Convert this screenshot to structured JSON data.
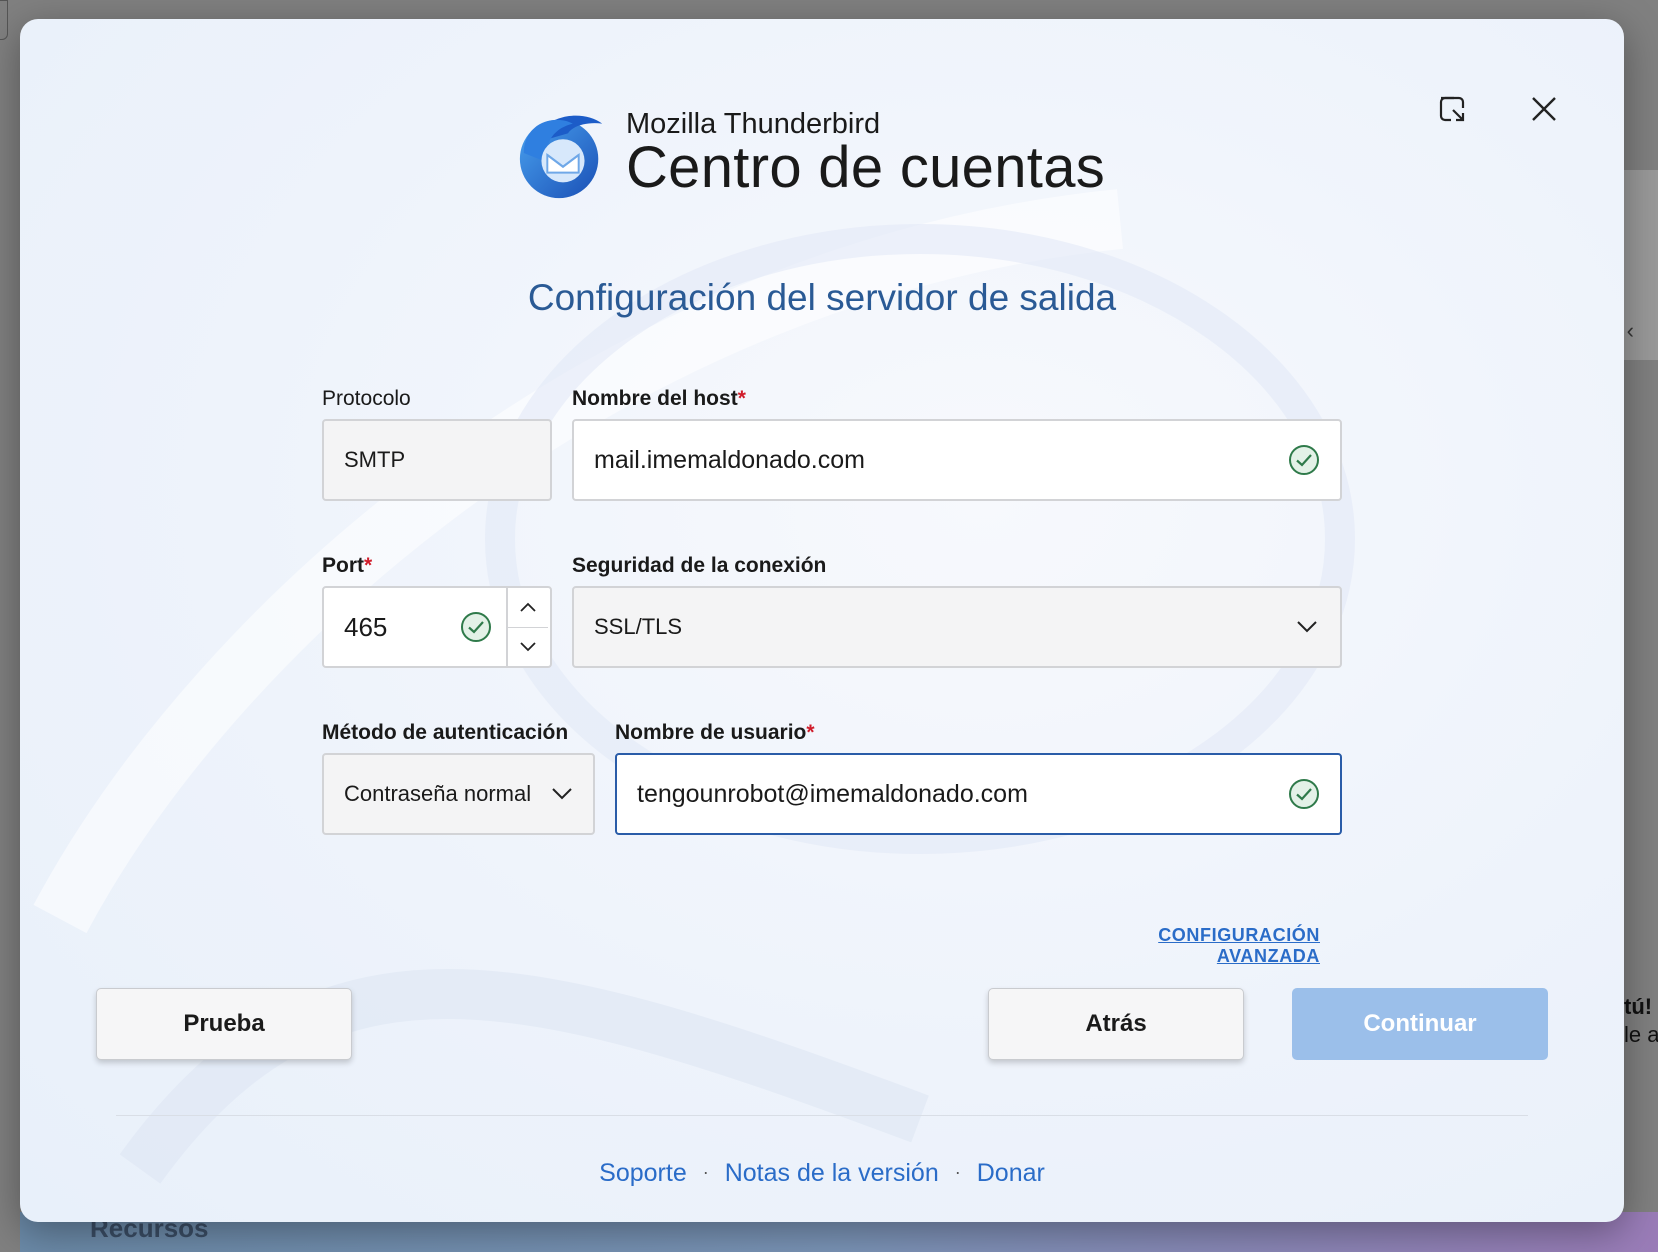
{
  "window": {
    "restore_icon": "restore-window-icon",
    "close_icon": "close-icon"
  },
  "brand": {
    "product": "Mozilla Thunderbird",
    "title": "Centro de cuentas"
  },
  "form": {
    "title": "Configuración del servidor de salida",
    "protocol": {
      "label": "Protocolo",
      "value": "SMTP"
    },
    "hostname": {
      "label": "Nombre del host",
      "required_mark": "*",
      "value": "mail.imemaldonado.com"
    },
    "port": {
      "label": "Port",
      "required_mark": "*",
      "value": "465"
    },
    "security": {
      "label": "Seguridad de la conexión",
      "value": "SSL/TLS"
    },
    "auth": {
      "label": "Método de autenticación",
      "value": "Contraseña normal"
    },
    "username": {
      "label": "Nombre de usuario",
      "required_mark": "*",
      "value": "tengounrobot@imemaldonado.com"
    },
    "advanced_link": "CONFIGURACIÓN AVANZADA"
  },
  "buttons": {
    "test": "Prueba",
    "back": "Atrás",
    "continue": "Continuar"
  },
  "footer": {
    "support": "Soporte",
    "separator": "·",
    "release_notes": "Notas de la versión",
    "donate": "Donar"
  },
  "background": {
    "right_text_1": "tú!",
    "right_text_2": "le a",
    "bottom_text": "Recursos"
  },
  "colors": {
    "accent": "#2a5a95",
    "link": "#2a6cc8",
    "primary_disabled": "#9bbfea",
    "valid": "#2f7a4a",
    "required": "#d01c2a"
  }
}
